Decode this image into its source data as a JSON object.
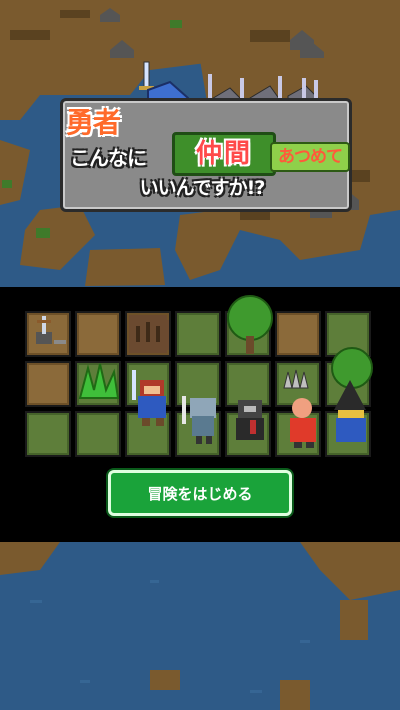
{
  "title": {
    "line1": "勇者",
    "line2a": "こんなに",
    "line2b": "仲間",
    "line2c": "あつめて",
    "line3": "いいんですか!?"
  },
  "start_button": {
    "label": "冒険をはじめる"
  },
  "colors": {
    "sea": "#2e5a87",
    "land": "#7a5a2e",
    "grass": "#5e7e3a",
    "button": "#1aa33a"
  },
  "board": {
    "rows": [
      [
        "dirt",
        "dirt",
        "dirt-dark",
        "grass",
        "grass",
        "dirt",
        "grass"
      ],
      [
        "dirt",
        "grass",
        "grass",
        "grass",
        "grass",
        "grass",
        "grass"
      ],
      [
        "grass",
        "grass",
        "grass",
        "grass",
        "grass",
        "grass",
        "grass"
      ]
    ]
  },
  "icons": [
    "sword-in-stone-icon",
    "bush-icon",
    "tree-icon",
    "hero-icon",
    "knight-icon",
    "soldier-icon",
    "monk-icon",
    "wizard-icon",
    "spike-trap-icon"
  ]
}
